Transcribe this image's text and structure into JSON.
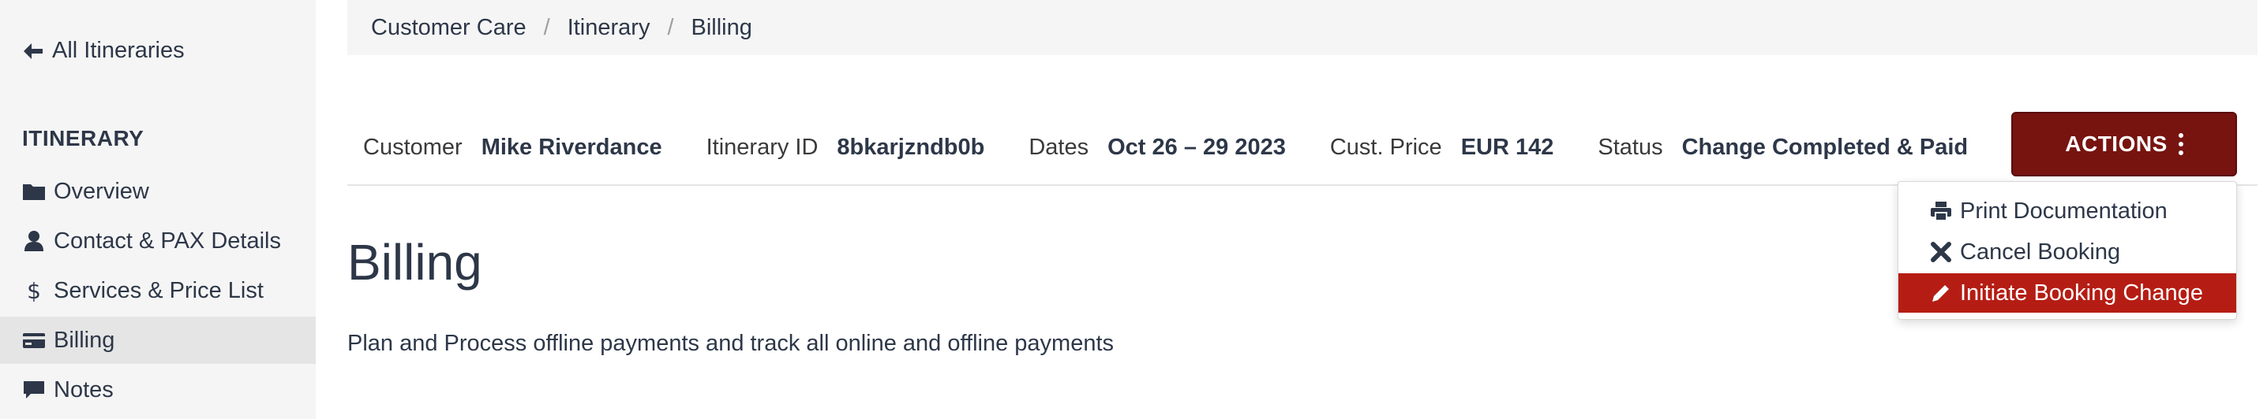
{
  "sidebar": {
    "back_label": "All Itineraries",
    "section_heading": "ITINERARY",
    "items": [
      {
        "label": "Overview",
        "icon": "folder-icon"
      },
      {
        "label": "Contact & PAX Details",
        "icon": "user-icon"
      },
      {
        "label": "Services & Price List",
        "icon": "dollar-icon"
      },
      {
        "label": "Billing",
        "icon": "credit-card-icon",
        "active": true
      },
      {
        "label": "Notes",
        "icon": "comment-icon"
      }
    ]
  },
  "breadcrumb": [
    "Customer Care",
    "Itinerary",
    "Billing"
  ],
  "info": {
    "customer_label": "Customer",
    "customer_value": "Mike Riverdance",
    "itinerary_label": "Itinerary ID",
    "itinerary_value": "8bkarjzndb0b",
    "dates_label": "Dates",
    "dates_value": "Oct 26 – 29 2023",
    "price_label": "Cust. Price",
    "price_value": "EUR 142",
    "status_label": "Status",
    "status_value": "Change Completed & Paid"
  },
  "actions": {
    "label": "ACTIONS",
    "menu": [
      {
        "label": "Print Documentation",
        "icon": "print-icon"
      },
      {
        "label": "Cancel Booking",
        "icon": "close-icon"
      },
      {
        "label": "Initiate Booking Change",
        "icon": "pencil-icon",
        "active": true
      }
    ]
  },
  "main": {
    "title": "Billing",
    "description": "Plan and Process offline payments and track all online and offline payments"
  },
  "colors": {
    "actions_bg": "#771410",
    "menu_active_bg": "#b51d14",
    "sidebar_bg": "#f5f5f5",
    "text": "#2d3748"
  }
}
